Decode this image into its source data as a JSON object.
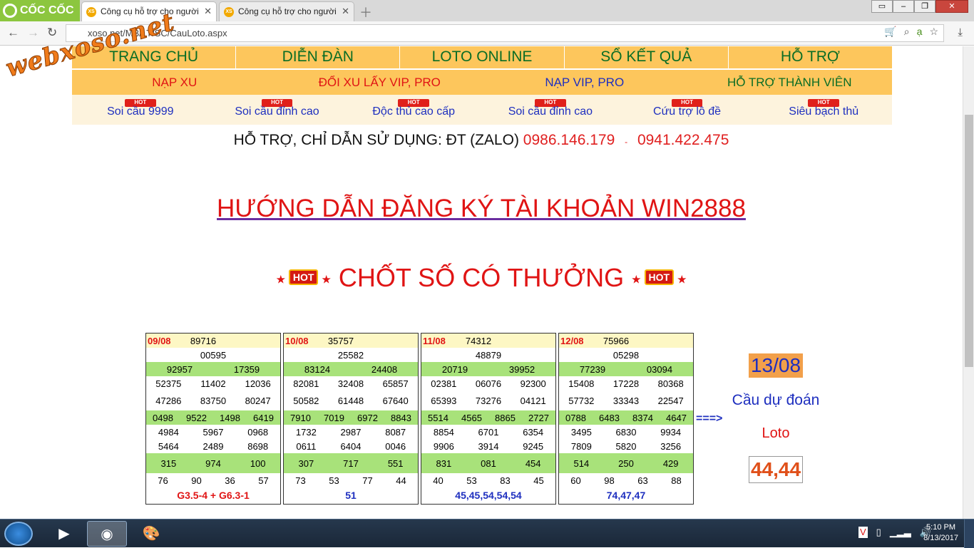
{
  "browser": {
    "brand": "CỐC CỐC",
    "tabs": [
      {
        "title": "Công cụ hỗ trợ cho người",
        "active": true
      },
      {
        "title": "Công cụ hỗ trợ cho người",
        "active": false
      }
    ],
    "url": "xoso.net/MB/LT/SC/CauLoto.aspx",
    "watermark": "webxoso.net"
  },
  "menu_top": [
    "TRANG CHỦ",
    "DIỄN ĐÀN",
    "LOTO ONLINE",
    "SỔ KẾT QUẢ",
    "HỖ TRỢ"
  ],
  "menu_second": [
    {
      "label": "NẠP XU",
      "color": "#e01414"
    },
    {
      "label": "ĐỔI XU LẤY VIP, PRO",
      "color": "#e01414"
    },
    {
      "label": "NẠP VIP, PRO",
      "color": "#1e2fbf"
    },
    {
      "label": "HỖ TRỢ THÀNH VIÊN",
      "color": "#0a6d25"
    }
  ],
  "menu_third": {
    "hot_label": "HOT",
    "items": [
      "Soi cầu 9999",
      "Soi cầu đỉnh cao",
      "Độc thủ cao cấp",
      "Soi cầu đỉnh cao",
      "Cứu trợ lô đề",
      "Siêu bạch thủ"
    ]
  },
  "support": {
    "text": "HỖ TRỢ, CHỈ DẪN SỬ DỤNG: ĐT (ZALO)",
    "phone1": "0986.146.179",
    "sep": "-",
    "phone2": "0941.422.475"
  },
  "guide_link": "HƯỚNG DẪN ĐĂNG KÝ TÀI KHOẢN WIN2888",
  "chot_title": "CHỐT SỐ CÓ THƯỞNG",
  "hot": "HOT",
  "tables": [
    {
      "date": "09/08",
      "db": "89716",
      "g1": "00595",
      "g2": [
        "92957",
        "17359"
      ],
      "g3a": [
        "52375",
        "11402",
        "12036"
      ],
      "g3b": [
        "47286",
        "83750",
        "80247"
      ],
      "g4": [
        "0498",
        "9522",
        "1498",
        "6419"
      ],
      "g5a": [
        "4984",
        "5967",
        "0968"
      ],
      "g5b": [
        "5464",
        "2489",
        "8698"
      ],
      "g6": [
        "315",
        "974",
        "100"
      ],
      "g7": [
        "76",
        "90",
        "36",
        "57"
      ],
      "footer": "G3.5-4 + G6.3-1",
      "footer_color": "#e01414"
    },
    {
      "date": "10/08",
      "db": "35757",
      "g1": "25582",
      "g2": [
        "83124",
        "24408"
      ],
      "g3a": [
        "82081",
        "32408",
        "65857"
      ],
      "g3b": [
        "50582",
        "61448",
        "67640"
      ],
      "g4": [
        "7910",
        "7019",
        "6972",
        "8843"
      ],
      "g5a": [
        "1732",
        "2987",
        "8087"
      ],
      "g5b": [
        "0611",
        "6404",
        "0046"
      ],
      "g6": [
        "307",
        "717",
        "551"
      ],
      "g7": [
        "73",
        "53",
        "77",
        "44"
      ],
      "footer": "51",
      "footer_color": "#1e2fbf"
    },
    {
      "date": "11/08",
      "db": "74312",
      "g1": "48879",
      "g2": [
        "20719",
        "39952"
      ],
      "g3a": [
        "02381",
        "06076",
        "92300"
      ],
      "g3b": [
        "65393",
        "73276",
        "04121"
      ],
      "g4": [
        "5514",
        "4565",
        "8865",
        "2727"
      ],
      "g5a": [
        "8854",
        "6701",
        "6354"
      ],
      "g5b": [
        "9906",
        "3914",
        "9245"
      ],
      "g6": [
        "831",
        "081",
        "454"
      ],
      "g7": [
        "40",
        "53",
        "83",
        "45"
      ],
      "footer": "45,45,54,54,54",
      "footer_color": "#1e2fbf"
    },
    {
      "date": "12/08",
      "db": "75966",
      "g1": "05298",
      "g2": [
        "77239",
        "03094"
      ],
      "g3a": [
        "15408",
        "17228",
        "80368"
      ],
      "g3b": [
        "57732",
        "33343",
        "22547"
      ],
      "g4": [
        "0788",
        "6483",
        "8374",
        "4647"
      ],
      "g5a": [
        "3495",
        "6830",
        "9934"
      ],
      "g5b": [
        "7809",
        "5820",
        "3256"
      ],
      "g6": [
        "514",
        "250",
        "429"
      ],
      "g7": [
        "60",
        "98",
        "63",
        "88"
      ],
      "footer": "74,47,47",
      "footer_color": "#1e2fbf"
    }
  ],
  "arrow": "===>",
  "prediction": {
    "date": "13/08",
    "label": "Cầu dự đoán",
    "type": "Loto",
    "numbers": "44,44"
  },
  "taskbar": {
    "time": "5:10 PM",
    "date": "8/13/2017"
  }
}
